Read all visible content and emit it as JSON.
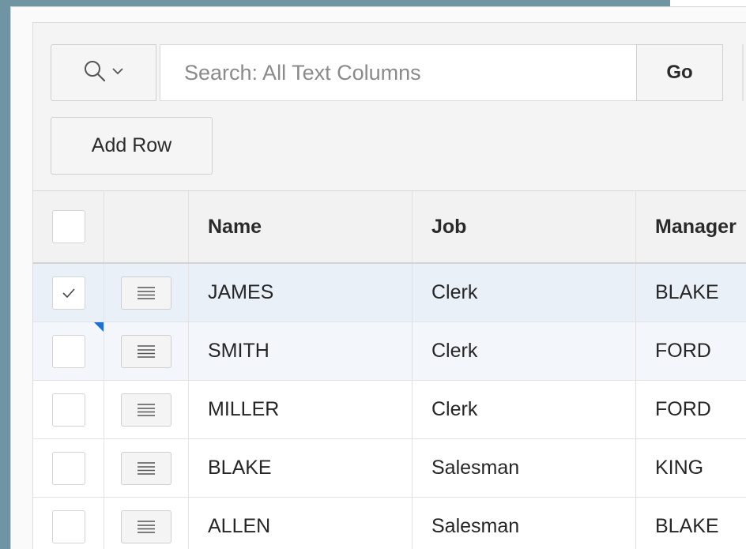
{
  "colors": {
    "backdrop": "#6f95a3",
    "panel": "#f4f4f4",
    "header": "#f2f2f2",
    "selected_row": "#eaf0f8",
    "changed_marker": "#1f6fd1"
  },
  "toolbar": {
    "search_scope_icon": "search-icon",
    "search_scope_chevron": "chevron-down-icon",
    "search_placeholder": "Search: All Text Columns",
    "search_value": "",
    "go_label": "Go",
    "add_row_label": "Add Row"
  },
  "grid": {
    "columns": [
      "Name",
      "Job",
      "Manager"
    ],
    "row_action_icon": "row-actions-menu-icon",
    "rows": [
      {
        "name": "JAMES",
        "job": "Clerk",
        "manager": "BLAKE",
        "selected": true,
        "changed": false
      },
      {
        "name": "SMITH",
        "job": "Clerk",
        "manager": "FORD",
        "selected": false,
        "changed": true
      },
      {
        "name": "MILLER",
        "job": "Clerk",
        "manager": "FORD",
        "selected": false,
        "changed": false
      },
      {
        "name": "BLAKE",
        "job": "Salesman",
        "manager": "KING",
        "selected": false,
        "changed": false
      },
      {
        "name": "ALLEN",
        "job": "Salesman",
        "manager": "BLAKE",
        "selected": false,
        "changed": false
      }
    ]
  }
}
